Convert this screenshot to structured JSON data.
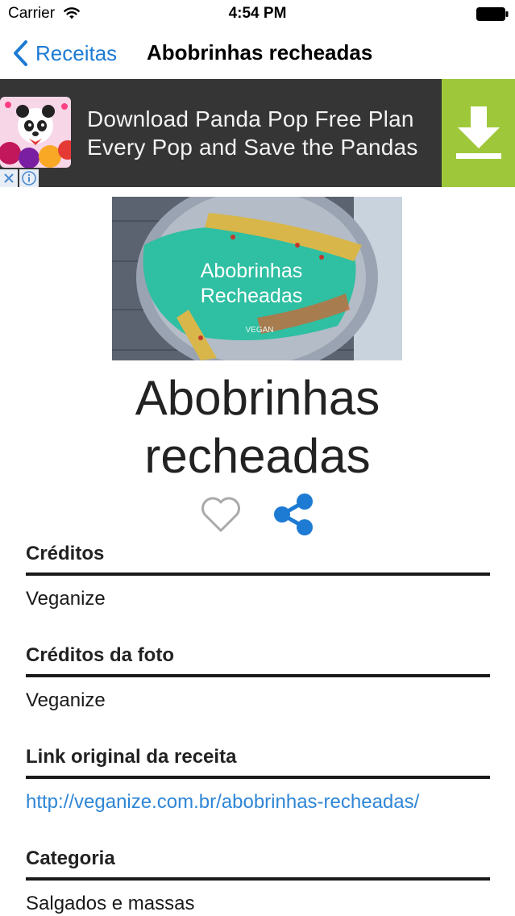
{
  "status_bar": {
    "carrier": "Carrier",
    "time": "4:54 PM",
    "wifi_icon": "wifi-icon",
    "battery_icon": "battery-icon"
  },
  "nav": {
    "back_label": "Receitas",
    "title": "Abobrinhas recheadas",
    "accent_color": "#1d7bd4"
  },
  "ad": {
    "line1": "Download Panda Pop Free Plan",
    "line2": "Every Pop and Save the Pandas",
    "download_icon": "download-arrow-icon",
    "download_color": "#9ec83a",
    "close_icon": "close-icon",
    "info_icon": "info-icon"
  },
  "recipe": {
    "image_title_line1": "Abobrinhas",
    "image_title_line2": "Recheadas",
    "image_badge": "VEGAN",
    "title_line1": "Abobrinhas",
    "title_line2": "recheadas",
    "favorite_icon": "heart-outline-icon",
    "share_icon": "share-icon"
  },
  "sections": [
    {
      "heading": "Créditos",
      "value": "Veganize"
    },
    {
      "heading": "Créditos da foto",
      "value": "Veganize"
    },
    {
      "heading": "Link original da receita",
      "value": "http://veganize.com.br/abobrinhas-recheadas/"
    },
    {
      "heading": "Categoria",
      "value": "Salgados e massas"
    }
  ]
}
